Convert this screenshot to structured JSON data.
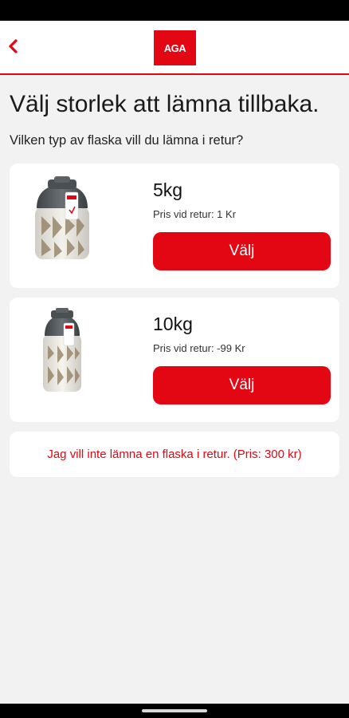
{
  "header": {
    "logo_text": "AGA",
    "back_icon": "chevron-left-icon",
    "accent_color": "#e30613"
  },
  "page": {
    "title": "Välj storlek att lämna tillbaka.",
    "subtitle": "Vilken typ av flaska vill du lämna i retur?"
  },
  "options": [
    {
      "size": "5kg",
      "price": "Pris vid retur: 1 Kr",
      "button_label": "Välj",
      "image_icon": "gas-cylinder-5kg-icon"
    },
    {
      "size": "10kg",
      "price": "Pris vid retur: -99 Kr",
      "button_label": "Välj",
      "image_icon": "gas-cylinder-10kg-icon"
    }
  ],
  "no_return": {
    "label": "Jag vill inte lämna en flaska i retur. (Pris: 300 kr)"
  }
}
